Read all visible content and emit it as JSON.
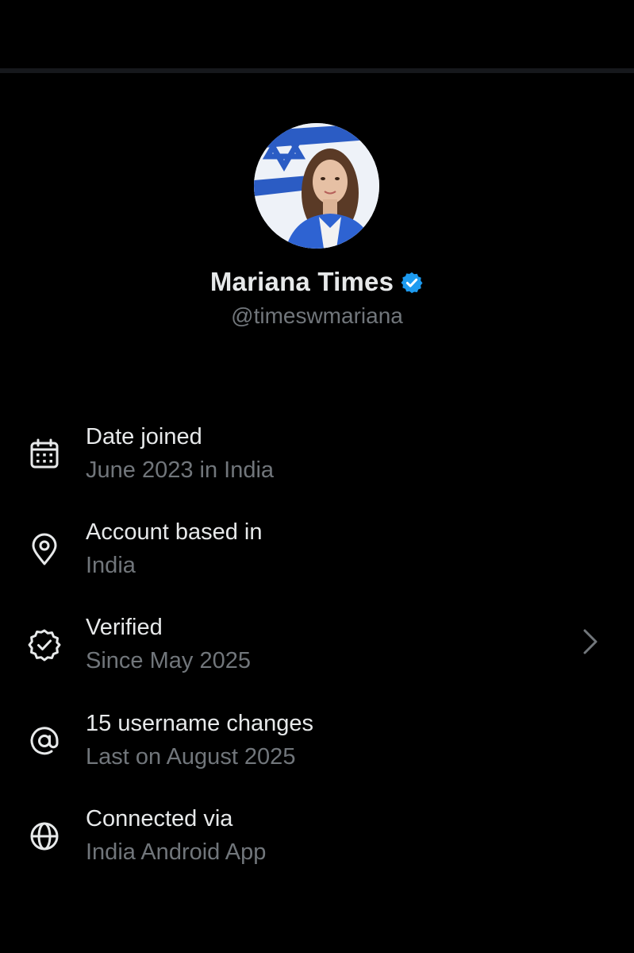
{
  "profile": {
    "display_name": "Mariana Times",
    "handle": "@timeswmariana",
    "verified": true,
    "verified_badge_color": "#1d9bf0"
  },
  "info_rows": [
    {
      "icon": "calendar-icon",
      "title": "Date joined",
      "subtitle": "June 2023 in India"
    },
    {
      "icon": "location-pin-icon",
      "title": "Account based in",
      "subtitle": "India"
    },
    {
      "icon": "verified-outline-icon",
      "title": "Verified",
      "subtitle": "Since May 2025",
      "has_chevron": true
    },
    {
      "icon": "at-sign-icon",
      "title": "15 username changes",
      "subtitle": "Last on August 2025"
    },
    {
      "icon": "globe-icon",
      "title": "Connected via",
      "subtitle": "India Android App"
    }
  ],
  "colors": {
    "background": "#000000",
    "primary_text": "#e7e9ea",
    "secondary_text": "#71767b",
    "accent": "#1d9bf0"
  }
}
